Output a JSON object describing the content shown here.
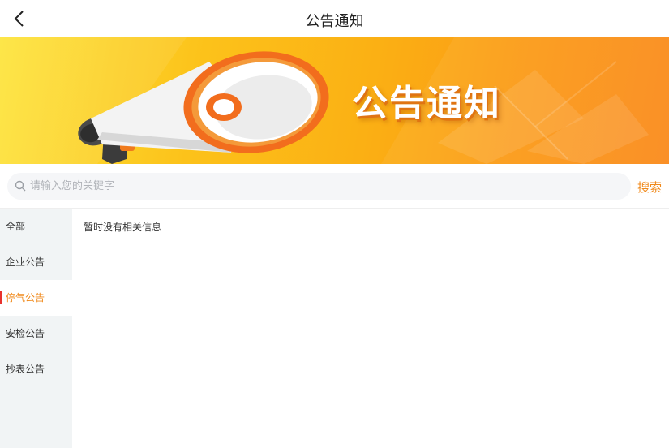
{
  "header": {
    "title": "公告通知",
    "back_icon": "chevron-left-icon"
  },
  "banner": {
    "text": "公告通知",
    "illustration": "megaphone-icon"
  },
  "search": {
    "placeholder": "请输入您的关键字",
    "value": "",
    "button_label": "搜索",
    "icon": "search-icon"
  },
  "sidebar": {
    "items": [
      {
        "label": "全部",
        "active": false
      },
      {
        "label": "企业公告",
        "active": false
      },
      {
        "label": "停气公告",
        "active": true
      },
      {
        "label": "安检公告",
        "active": false
      },
      {
        "label": "抄表公告",
        "active": false
      }
    ]
  },
  "content": {
    "empty_message": "暂时没有相关信息"
  },
  "colors": {
    "accent": "#f08a1c",
    "active_indicator": "#e8322e",
    "sidebar_bg": "#f1f4f5",
    "search_bg": "#f5f6f8"
  }
}
